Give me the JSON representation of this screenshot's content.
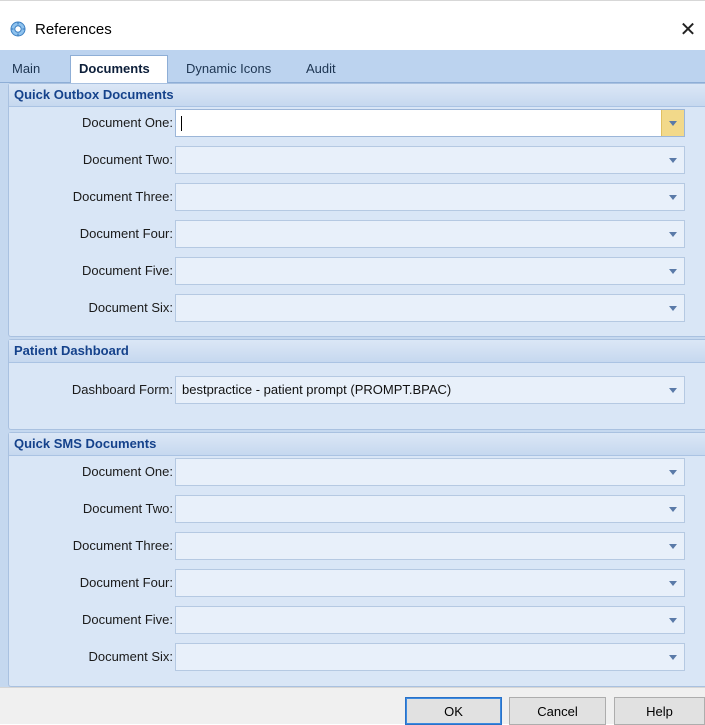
{
  "window": {
    "title": "References",
    "icon": "gear-app-icon"
  },
  "tabs": [
    {
      "label": "Main"
    },
    {
      "label": "Documents"
    },
    {
      "label": "Dynamic Icons"
    },
    {
      "label": "Audit"
    }
  ],
  "active_tab": "Documents",
  "quick_outbox": {
    "title": "Quick Outbox Documents",
    "fields": [
      {
        "label": "Document One:",
        "value": ""
      },
      {
        "label": "Document Two:",
        "value": ""
      },
      {
        "label": "Document Three:",
        "value": ""
      },
      {
        "label": "Document Four:",
        "value": ""
      },
      {
        "label": "Document Five:",
        "value": ""
      },
      {
        "label": "Document Six:",
        "value": ""
      }
    ]
  },
  "patient_dashboard": {
    "title": "Patient Dashboard",
    "field": {
      "label": "Dashboard Form:",
      "value": "bestpractice - patient prompt (PROMPT.BPAC)"
    }
  },
  "quick_sms": {
    "title": "Quick SMS Documents",
    "fields": [
      {
        "label": "Document One:",
        "value": ""
      },
      {
        "label": "Document Two:",
        "value": ""
      },
      {
        "label": "Document Three:",
        "value": ""
      },
      {
        "label": "Document Four:",
        "value": ""
      },
      {
        "label": "Document Five:",
        "value": ""
      },
      {
        "label": "Document Six:",
        "value": ""
      }
    ]
  },
  "footer": {
    "ok": "OK",
    "cancel": "Cancel",
    "help": "Help"
  }
}
